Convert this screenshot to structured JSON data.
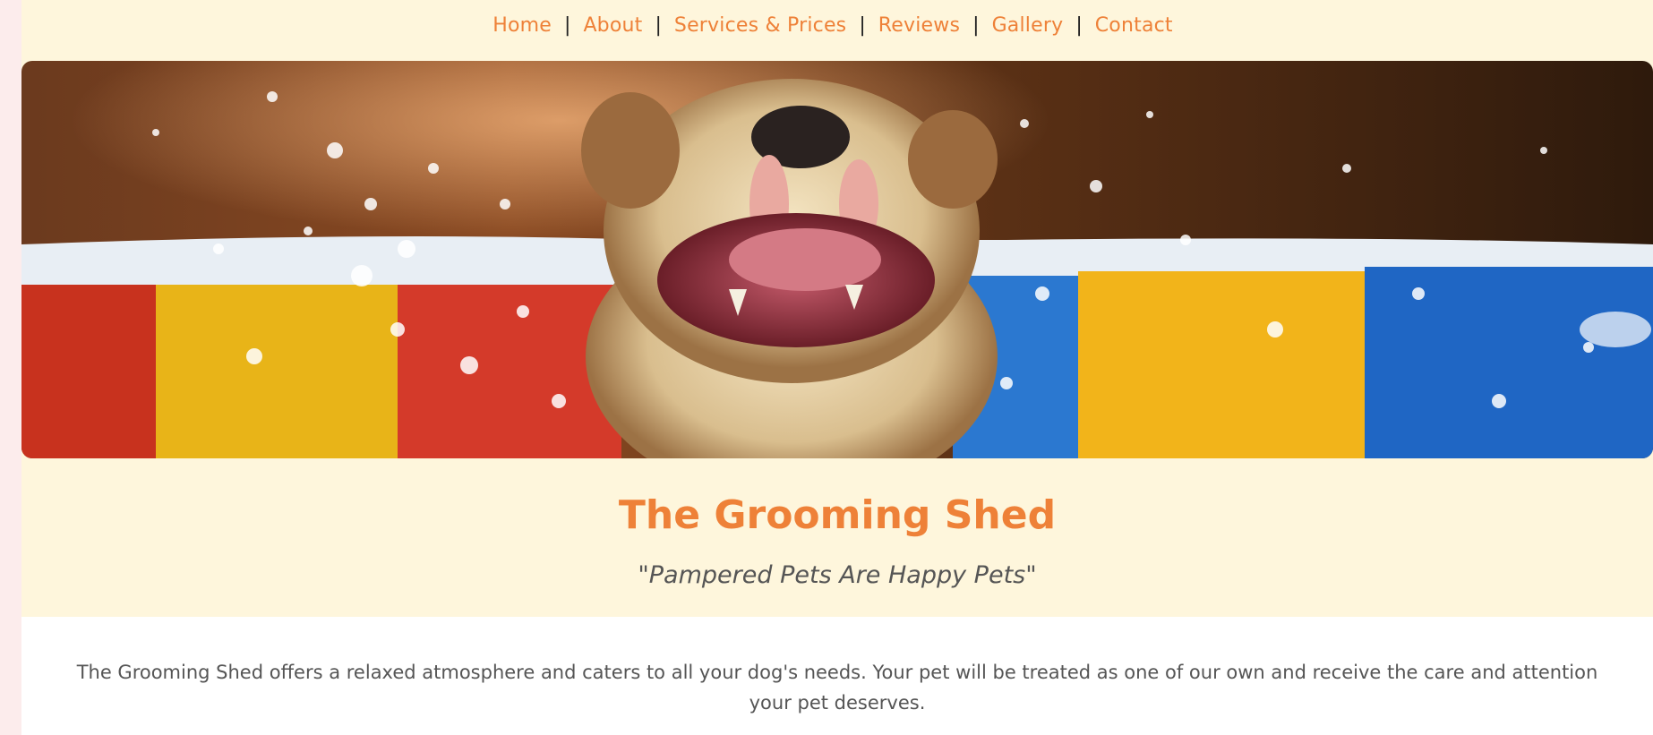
{
  "nav": {
    "items": [
      {
        "label": "Home"
      },
      {
        "label": "About"
      },
      {
        "label": "Services & Prices"
      },
      {
        "label": "Reviews"
      },
      {
        "label": "Gallery"
      },
      {
        "label": "Contact"
      }
    ],
    "separator": "|"
  },
  "hero": {
    "image": "bulldog-splashing-in-paddling-pool"
  },
  "site": {
    "title": "The Grooming Shed",
    "tagline": "\"Pampered Pets Are Happy Pets\""
  },
  "intro": {
    "text": "The Grooming Shed offers a relaxed atmosphere and caters to all your dog's needs. Your pet will be treated as one of our own and receive the care and attention your pet deserves."
  },
  "colors": {
    "accent": "#ee8138",
    "background": "#fef6dc",
    "text": "#555555"
  }
}
